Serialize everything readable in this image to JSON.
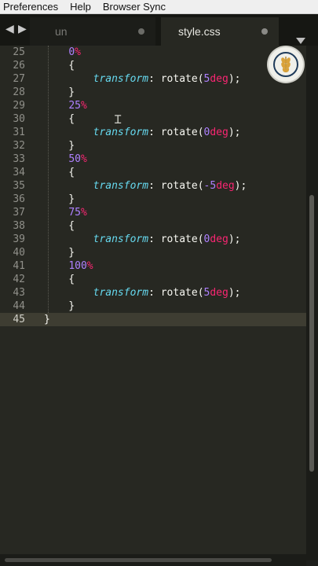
{
  "menu": [
    "Preferences",
    "Help",
    "Browser Sync"
  ],
  "tabs": [
    {
      "label": "un",
      "active": false
    },
    {
      "label": "style.css",
      "active": true
    }
  ],
  "lines": [
    {
      "n": "25",
      "segs": [
        [
          "    ",
          ""
        ],
        [
          "0",
          "num"
        ],
        [
          "%",
          "unit"
        ]
      ]
    },
    {
      "n": "26",
      "segs": [
        [
          "    {",
          ""
        ]
      ]
    },
    {
      "n": "27",
      "segs": [
        [
          "        ",
          ""
        ],
        [
          "transform",
          "prop"
        ],
        [
          ": rotate(",
          ""
        ],
        [
          "5",
          "num"
        ],
        [
          "deg",
          "unit"
        ],
        [
          ");",
          ""
        ]
      ]
    },
    {
      "n": "28",
      "segs": [
        [
          "    }",
          ""
        ]
      ]
    },
    {
      "n": "29",
      "segs": [
        [
          "    ",
          ""
        ],
        [
          "25",
          "num"
        ],
        [
          "%",
          "unit"
        ]
      ]
    },
    {
      "n": "30",
      "segs": [
        [
          "    {",
          ""
        ]
      ]
    },
    {
      "n": "31",
      "segs": [
        [
          "        ",
          ""
        ],
        [
          "transform",
          "prop"
        ],
        [
          ": rotate(",
          ""
        ],
        [
          "0",
          "num"
        ],
        [
          "deg",
          "unit"
        ],
        [
          ");",
          ""
        ]
      ]
    },
    {
      "n": "32",
      "segs": [
        [
          "    }",
          ""
        ]
      ]
    },
    {
      "n": "33",
      "segs": [
        [
          "    ",
          ""
        ],
        [
          "50",
          "num"
        ],
        [
          "%",
          "unit"
        ]
      ]
    },
    {
      "n": "34",
      "segs": [
        [
          "    {",
          ""
        ]
      ]
    },
    {
      "n": "35",
      "segs": [
        [
          "        ",
          ""
        ],
        [
          "transform",
          "prop"
        ],
        [
          ": rotate(",
          ""
        ],
        [
          "-5",
          "num"
        ],
        [
          "deg",
          "unit"
        ],
        [
          ");",
          ""
        ]
      ]
    },
    {
      "n": "36",
      "segs": [
        [
          "    }",
          ""
        ]
      ]
    },
    {
      "n": "37",
      "segs": [
        [
          "    ",
          ""
        ],
        [
          "75",
          "num"
        ],
        [
          "%",
          "unit"
        ]
      ]
    },
    {
      "n": "38",
      "segs": [
        [
          "    {",
          ""
        ]
      ]
    },
    {
      "n": "39",
      "segs": [
        [
          "        ",
          ""
        ],
        [
          "transform",
          "prop"
        ],
        [
          ": rotate(",
          ""
        ],
        [
          "0",
          "num"
        ],
        [
          "deg",
          "unit"
        ],
        [
          ");",
          ""
        ]
      ]
    },
    {
      "n": "40",
      "segs": [
        [
          "    }",
          ""
        ]
      ]
    },
    {
      "n": "41",
      "segs": [
        [
          "    ",
          ""
        ],
        [
          "100",
          "num"
        ],
        [
          "%",
          "unit"
        ]
      ]
    },
    {
      "n": "42",
      "segs": [
        [
          "    {",
          ""
        ]
      ]
    },
    {
      "n": "43",
      "segs": [
        [
          "        ",
          ""
        ],
        [
          "transform",
          "prop"
        ],
        [
          ": rotate(",
          ""
        ],
        [
          "5",
          "num"
        ],
        [
          "deg",
          "unit"
        ],
        [
          ");",
          ""
        ]
      ]
    },
    {
      "n": "44",
      "segs": [
        [
          "    }",
          ""
        ]
      ]
    },
    {
      "n": "45",
      "segs": [
        [
          "}",
          ""
        ]
      ],
      "current": true
    }
  ],
  "colors": {
    "background": "#272822",
    "keyword": "#f92672",
    "number": "#ae81ff",
    "property": "#66d9ef",
    "text": "#f8f8f2",
    "line_number": "#90908a"
  },
  "icons": {
    "nav_back": "◀",
    "nav_forward": "▶",
    "tab_dirty": "dirty-dot-icon",
    "overflow": "tab-list-dropdown-icon",
    "logo": "wheat-emblem-icon",
    "cursor": "Ɪ"
  }
}
